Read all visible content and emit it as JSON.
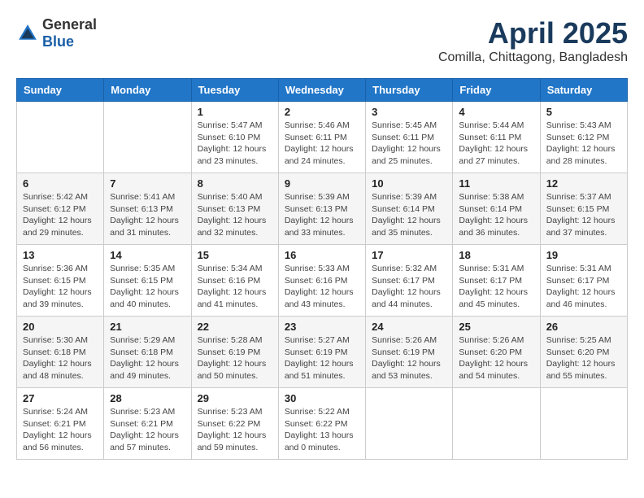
{
  "logo": {
    "general": "General",
    "blue": "Blue"
  },
  "header": {
    "month_title": "April 2025",
    "location": "Comilla, Chittagong, Bangladesh"
  },
  "weekdays": [
    "Sunday",
    "Monday",
    "Tuesday",
    "Wednesday",
    "Thursday",
    "Friday",
    "Saturday"
  ],
  "weeks": [
    [
      {
        "day": "",
        "sunrise": "",
        "sunset": "",
        "daylight": ""
      },
      {
        "day": "",
        "sunrise": "",
        "sunset": "",
        "daylight": ""
      },
      {
        "day": "1",
        "sunrise": "Sunrise: 5:47 AM",
        "sunset": "Sunset: 6:10 PM",
        "daylight": "Daylight: 12 hours and 23 minutes."
      },
      {
        "day": "2",
        "sunrise": "Sunrise: 5:46 AM",
        "sunset": "Sunset: 6:11 PM",
        "daylight": "Daylight: 12 hours and 24 minutes."
      },
      {
        "day": "3",
        "sunrise": "Sunrise: 5:45 AM",
        "sunset": "Sunset: 6:11 PM",
        "daylight": "Daylight: 12 hours and 25 minutes."
      },
      {
        "day": "4",
        "sunrise": "Sunrise: 5:44 AM",
        "sunset": "Sunset: 6:11 PM",
        "daylight": "Daylight: 12 hours and 27 minutes."
      },
      {
        "day": "5",
        "sunrise": "Sunrise: 5:43 AM",
        "sunset": "Sunset: 6:12 PM",
        "daylight": "Daylight: 12 hours and 28 minutes."
      }
    ],
    [
      {
        "day": "6",
        "sunrise": "Sunrise: 5:42 AM",
        "sunset": "Sunset: 6:12 PM",
        "daylight": "Daylight: 12 hours and 29 minutes."
      },
      {
        "day": "7",
        "sunrise": "Sunrise: 5:41 AM",
        "sunset": "Sunset: 6:13 PM",
        "daylight": "Daylight: 12 hours and 31 minutes."
      },
      {
        "day": "8",
        "sunrise": "Sunrise: 5:40 AM",
        "sunset": "Sunset: 6:13 PM",
        "daylight": "Daylight: 12 hours and 32 minutes."
      },
      {
        "day": "9",
        "sunrise": "Sunrise: 5:39 AM",
        "sunset": "Sunset: 6:13 PM",
        "daylight": "Daylight: 12 hours and 33 minutes."
      },
      {
        "day": "10",
        "sunrise": "Sunrise: 5:39 AM",
        "sunset": "Sunset: 6:14 PM",
        "daylight": "Daylight: 12 hours and 35 minutes."
      },
      {
        "day": "11",
        "sunrise": "Sunrise: 5:38 AM",
        "sunset": "Sunset: 6:14 PM",
        "daylight": "Daylight: 12 hours and 36 minutes."
      },
      {
        "day": "12",
        "sunrise": "Sunrise: 5:37 AM",
        "sunset": "Sunset: 6:15 PM",
        "daylight": "Daylight: 12 hours and 37 minutes."
      }
    ],
    [
      {
        "day": "13",
        "sunrise": "Sunrise: 5:36 AM",
        "sunset": "Sunset: 6:15 PM",
        "daylight": "Daylight: 12 hours and 39 minutes."
      },
      {
        "day": "14",
        "sunrise": "Sunrise: 5:35 AM",
        "sunset": "Sunset: 6:15 PM",
        "daylight": "Daylight: 12 hours and 40 minutes."
      },
      {
        "day": "15",
        "sunrise": "Sunrise: 5:34 AM",
        "sunset": "Sunset: 6:16 PM",
        "daylight": "Daylight: 12 hours and 41 minutes."
      },
      {
        "day": "16",
        "sunrise": "Sunrise: 5:33 AM",
        "sunset": "Sunset: 6:16 PM",
        "daylight": "Daylight: 12 hours and 43 minutes."
      },
      {
        "day": "17",
        "sunrise": "Sunrise: 5:32 AM",
        "sunset": "Sunset: 6:17 PM",
        "daylight": "Daylight: 12 hours and 44 minutes."
      },
      {
        "day": "18",
        "sunrise": "Sunrise: 5:31 AM",
        "sunset": "Sunset: 6:17 PM",
        "daylight": "Daylight: 12 hours and 45 minutes."
      },
      {
        "day": "19",
        "sunrise": "Sunrise: 5:31 AM",
        "sunset": "Sunset: 6:17 PM",
        "daylight": "Daylight: 12 hours and 46 minutes."
      }
    ],
    [
      {
        "day": "20",
        "sunrise": "Sunrise: 5:30 AM",
        "sunset": "Sunset: 6:18 PM",
        "daylight": "Daylight: 12 hours and 48 minutes."
      },
      {
        "day": "21",
        "sunrise": "Sunrise: 5:29 AM",
        "sunset": "Sunset: 6:18 PM",
        "daylight": "Daylight: 12 hours and 49 minutes."
      },
      {
        "day": "22",
        "sunrise": "Sunrise: 5:28 AM",
        "sunset": "Sunset: 6:19 PM",
        "daylight": "Daylight: 12 hours and 50 minutes."
      },
      {
        "day": "23",
        "sunrise": "Sunrise: 5:27 AM",
        "sunset": "Sunset: 6:19 PM",
        "daylight": "Daylight: 12 hours and 51 minutes."
      },
      {
        "day": "24",
        "sunrise": "Sunrise: 5:26 AM",
        "sunset": "Sunset: 6:19 PM",
        "daylight": "Daylight: 12 hours and 53 minutes."
      },
      {
        "day": "25",
        "sunrise": "Sunrise: 5:26 AM",
        "sunset": "Sunset: 6:20 PM",
        "daylight": "Daylight: 12 hours and 54 minutes."
      },
      {
        "day": "26",
        "sunrise": "Sunrise: 5:25 AM",
        "sunset": "Sunset: 6:20 PM",
        "daylight": "Daylight: 12 hours and 55 minutes."
      }
    ],
    [
      {
        "day": "27",
        "sunrise": "Sunrise: 5:24 AM",
        "sunset": "Sunset: 6:21 PM",
        "daylight": "Daylight: 12 hours and 56 minutes."
      },
      {
        "day": "28",
        "sunrise": "Sunrise: 5:23 AM",
        "sunset": "Sunset: 6:21 PM",
        "daylight": "Daylight: 12 hours and 57 minutes."
      },
      {
        "day": "29",
        "sunrise": "Sunrise: 5:23 AM",
        "sunset": "Sunset: 6:22 PM",
        "daylight": "Daylight: 12 hours and 59 minutes."
      },
      {
        "day": "30",
        "sunrise": "Sunrise: 5:22 AM",
        "sunset": "Sunset: 6:22 PM",
        "daylight": "Daylight: 13 hours and 0 minutes."
      },
      {
        "day": "",
        "sunrise": "",
        "sunset": "",
        "daylight": ""
      },
      {
        "day": "",
        "sunrise": "",
        "sunset": "",
        "daylight": ""
      },
      {
        "day": "",
        "sunrise": "",
        "sunset": "",
        "daylight": ""
      }
    ]
  ]
}
